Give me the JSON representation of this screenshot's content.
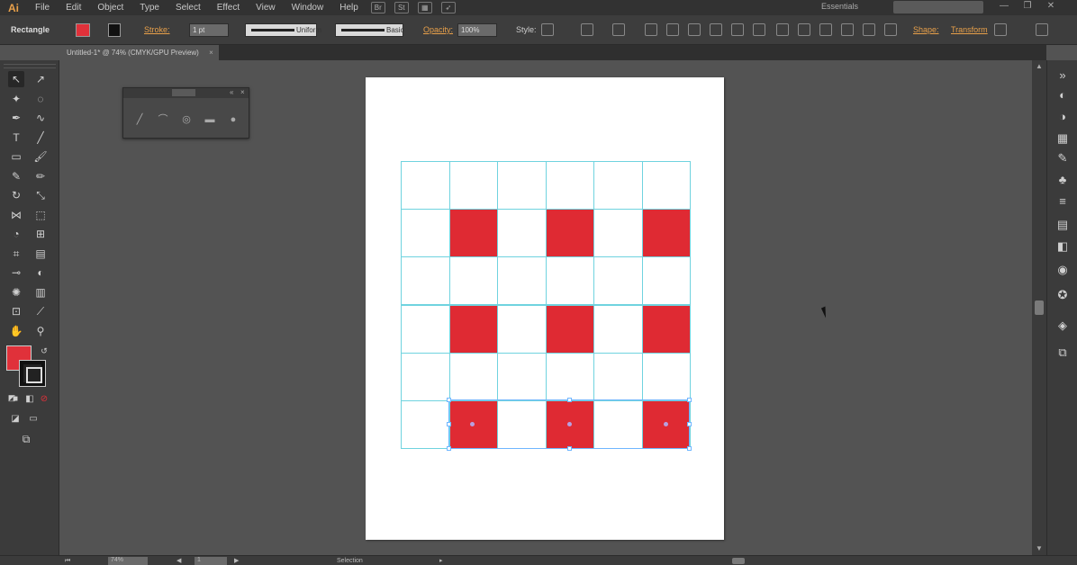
{
  "app": {
    "logo": "Ai",
    "menus": [
      "File",
      "Edit",
      "Object",
      "Type",
      "Select",
      "Effect",
      "View",
      "Window",
      "Help"
    ],
    "workspace": "Essentials",
    "window_controls": [
      "—",
      "❐",
      "✕"
    ]
  },
  "control_bar": {
    "selection_type": "Rectangle",
    "stroke_label": "Stroke:",
    "stroke_weight": "1 pt",
    "variable_width_profile": "Uniform",
    "brush_definition": "Basic",
    "opacity_label": "Opacity:",
    "opacity_value": "100%",
    "style_label": "Style:",
    "shape_label": "Shape:",
    "transform_label": "Transform"
  },
  "document": {
    "tab_title": "Untitled-1* @ 74% (CMYK/GPU Preview)",
    "close": "×"
  },
  "colors": {
    "fill": "#df2a33",
    "stroke": "#111111",
    "grid_line": "#6fd3df",
    "selection": "#6fb6ff"
  },
  "tools": [
    {
      "name": "selection-tool-icon",
      "glyph": "↖"
    },
    {
      "name": "direct-selection-tool-icon",
      "glyph": "↗"
    },
    {
      "name": "magic-wand-tool-icon",
      "glyph": "✦"
    },
    {
      "name": "lasso-tool-icon",
      "glyph": "◌"
    },
    {
      "name": "pen-tool-icon",
      "glyph": "✒"
    },
    {
      "name": "curvature-tool-icon",
      "glyph": "∿"
    },
    {
      "name": "type-tool-icon",
      "glyph": "T"
    },
    {
      "name": "line-tool-icon",
      "glyph": "╱"
    },
    {
      "name": "rectangle-tool-icon",
      "glyph": "▭"
    },
    {
      "name": "paintbrush-tool-icon",
      "glyph": "🖌"
    },
    {
      "name": "shaper-tool-icon",
      "glyph": "✎"
    },
    {
      "name": "pencil-tool-icon",
      "glyph": "✏"
    },
    {
      "name": "rotate-tool-icon",
      "glyph": "↻"
    },
    {
      "name": "scale-tool-icon",
      "glyph": "⤡"
    },
    {
      "name": "width-tool-icon",
      "glyph": "⋈"
    },
    {
      "name": "free-transform-tool-icon",
      "glyph": "⬚"
    },
    {
      "name": "shape-builder-tool-icon",
      "glyph": "◔"
    },
    {
      "name": "perspective-grid-tool-icon",
      "glyph": "⊞"
    },
    {
      "name": "mesh-tool-icon",
      "glyph": "⌗"
    },
    {
      "name": "gradient-tool-icon",
      "glyph": "▤"
    },
    {
      "name": "eyedropper-tool-icon",
      "glyph": "⊸"
    },
    {
      "name": "blend-tool-icon",
      "glyph": "◐"
    },
    {
      "name": "symbol-sprayer-tool-icon",
      "glyph": "✺"
    },
    {
      "name": "column-graph-tool-icon",
      "glyph": "▥"
    },
    {
      "name": "artboard-tool-icon",
      "glyph": "⊡"
    },
    {
      "name": "slice-tool-icon",
      "glyph": "⟋"
    },
    {
      "name": "hand-tool-icon",
      "glyph": "✋"
    },
    {
      "name": "zoom-tool-icon",
      "glyph": "⚲"
    }
  ],
  "right_dock_icons": [
    "panel-collapse-icon",
    "color-icon",
    "color-guide-icon",
    "swatches-icon",
    "brushes-icon",
    "symbols-icon",
    "stroke-icon",
    "gradient-icon",
    "transparency-icon",
    "appearance-icon",
    "graphic-styles-icon",
    "layers-icon",
    "artboards-icon"
  ],
  "canvas": {
    "grid_rows": 6,
    "grid_cols": 6,
    "red_cells": [
      [
        1,
        1
      ],
      [
        1,
        3
      ],
      [
        1,
        5
      ],
      [
        3,
        1
      ],
      [
        3,
        3
      ],
      [
        3,
        5
      ],
      [
        5,
        1
      ],
      [
        5,
        3
      ],
      [
        5,
        5
      ]
    ]
  },
  "status_bar": {
    "zoom": "74%",
    "artboard_number": "1",
    "tool_status": "Selection"
  }
}
